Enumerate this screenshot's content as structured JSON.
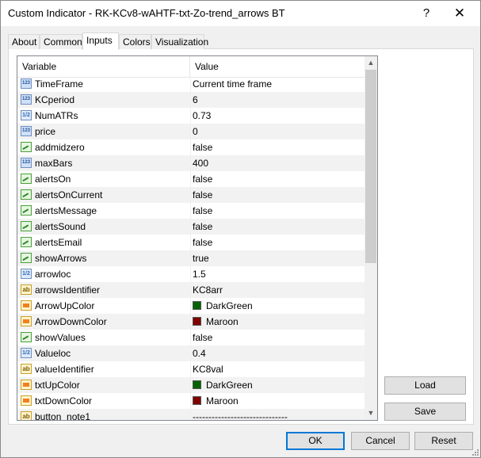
{
  "window": {
    "title": "Custom Indicator - RK-KCv8-wAHTF-txt-Zo-trend_arrows BT",
    "help_label": "?",
    "close_label": "✕"
  },
  "tabs": [
    {
      "label": "About"
    },
    {
      "label": "Common"
    },
    {
      "label": "Inputs",
      "active": true
    },
    {
      "label": "Colors"
    },
    {
      "label": "Visualization"
    }
  ],
  "grid": {
    "columns": {
      "variable": "Variable",
      "value": "Value"
    },
    "rows": [
      {
        "type": "int",
        "icon_text": "123",
        "name": "TimeFrame",
        "value": "Current time frame"
      },
      {
        "type": "int",
        "icon_text": "123",
        "name": "KCperiod",
        "value": "6"
      },
      {
        "type": "dbl",
        "icon_text": "1/2",
        "name": "NumATRs",
        "value": "0.73"
      },
      {
        "type": "int",
        "icon_text": "123",
        "name": "price",
        "value": "0"
      },
      {
        "type": "bool",
        "icon_text": "",
        "name": "addmidzero",
        "value": "false"
      },
      {
        "type": "int",
        "icon_text": "123",
        "name": "maxBars",
        "value": "400"
      },
      {
        "type": "bool",
        "icon_text": "",
        "name": "alertsOn",
        "value": "false"
      },
      {
        "type": "bool",
        "icon_text": "",
        "name": "alertsOnCurrent",
        "value": "false"
      },
      {
        "type": "bool",
        "icon_text": "",
        "name": "alertsMessage",
        "value": "false"
      },
      {
        "type": "bool",
        "icon_text": "",
        "name": "alertsSound",
        "value": "false"
      },
      {
        "type": "bool",
        "icon_text": "",
        "name": "alertsEmail",
        "value": "false"
      },
      {
        "type": "bool",
        "icon_text": "",
        "name": "showArrows",
        "value": "true"
      },
      {
        "type": "dbl",
        "icon_text": "1/2",
        "name": "arrowloc",
        "value": "1.5"
      },
      {
        "type": "str",
        "icon_text": "ab",
        "name": "arrowsIdentifier",
        "value": "KC8arr"
      },
      {
        "type": "col",
        "icon_text": "",
        "name": "ArrowUpColor",
        "value": "DarkGreen",
        "swatch": "#006400"
      },
      {
        "type": "col",
        "icon_text": "",
        "name": "ArrowDownColor",
        "value": "Maroon",
        "swatch": "#800000"
      },
      {
        "type": "bool",
        "icon_text": "",
        "name": "showValues",
        "value": "false"
      },
      {
        "type": "dbl",
        "icon_text": "1/2",
        "name": "Valueloc",
        "value": "0.4"
      },
      {
        "type": "str",
        "icon_text": "ab",
        "name": "valueIdentifier",
        "value": "KC8val"
      },
      {
        "type": "col",
        "icon_text": "",
        "name": "txtUpColor",
        "value": "DarkGreen",
        "swatch": "#006400"
      },
      {
        "type": "col",
        "icon_text": "",
        "name": "txtDownColor",
        "value": "Maroon",
        "swatch": "#800000"
      },
      {
        "type": "str",
        "icon_text": "ab",
        "name": "button_note1",
        "value": "------------------------------"
      }
    ],
    "scroll_up": "▲",
    "scroll_down": "▼"
  },
  "side_buttons": {
    "load": "Load",
    "save": "Save"
  },
  "footer": {
    "ok": "OK",
    "cancel": "Cancel",
    "reset": "Reset"
  }
}
